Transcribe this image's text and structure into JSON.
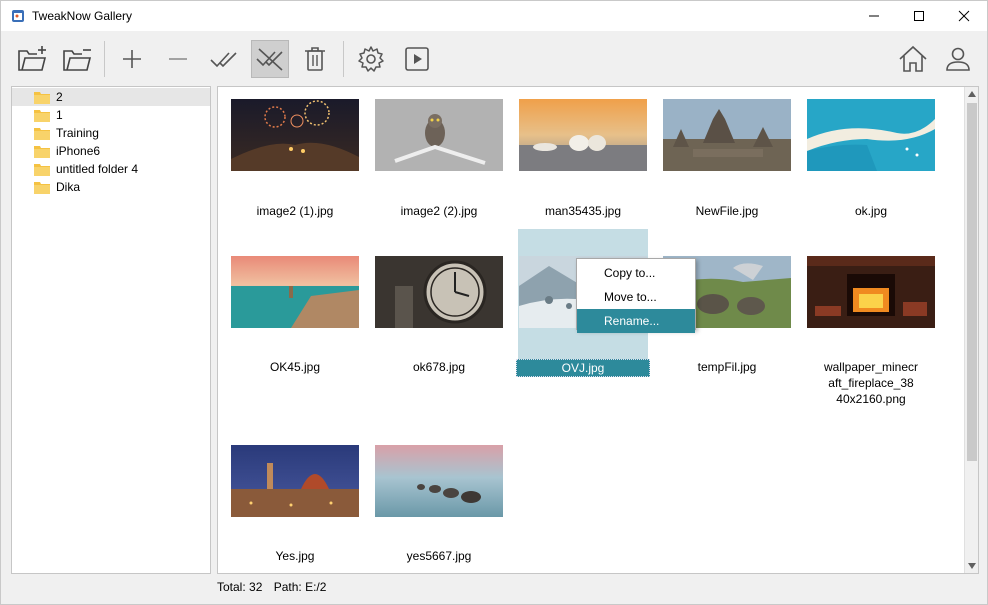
{
  "window": {
    "title": "TweakNow Gallery",
    "controls": [
      "minimize",
      "maximize",
      "close"
    ]
  },
  "toolbar": {
    "buttons": [
      {
        "name": "add-folder",
        "icon": "folder-plus-icon"
      },
      {
        "name": "remove-folder",
        "icon": "folder-minus-icon"
      },
      {
        "name": "add",
        "icon": "plus-icon"
      },
      {
        "name": "remove",
        "icon": "minus-icon"
      },
      {
        "name": "select-all",
        "icon": "double-check-icon"
      },
      {
        "name": "deselect-all",
        "icon": "double-check-off-icon",
        "active": true
      },
      {
        "name": "delete",
        "icon": "trash-icon"
      },
      {
        "name": "settings",
        "icon": "gear-icon"
      },
      {
        "name": "slideshow",
        "icon": "play-icon"
      },
      {
        "name": "home",
        "icon": "home-icon"
      },
      {
        "name": "account",
        "icon": "user-icon"
      }
    ]
  },
  "tree": {
    "items": [
      {
        "label": "2",
        "selected": true
      },
      {
        "label": "1"
      },
      {
        "label": "Training"
      },
      {
        "label": "iPhone6"
      },
      {
        "label": "untitled folder 4"
      },
      {
        "label": "Dika"
      }
    ]
  },
  "gallery": {
    "items": [
      {
        "filename": "image2 (1).jpg"
      },
      {
        "filename": "image2 (2).jpg"
      },
      {
        "filename": "man35435.jpg"
      },
      {
        "filename": "NewFile.jpg"
      },
      {
        "filename": "ok.jpg"
      },
      {
        "filename": "OK45.jpg"
      },
      {
        "filename": "ok678.jpg"
      },
      {
        "filename": "OVJ.jpg",
        "selected": true
      },
      {
        "filename": "tempFil.jpg"
      },
      {
        "filename_lines": [
          "wallpaper_minecr",
          "aft_fireplace_38",
          "40x2160.png"
        ]
      },
      {
        "filename": "Yes.jpg"
      },
      {
        "filename": "yes5667.jpg"
      }
    ]
  },
  "context_menu": {
    "items": [
      {
        "label": "Copy to..."
      },
      {
        "label": "Move to..."
      },
      {
        "label": "Rename...",
        "highlighted": true
      }
    ]
  },
  "status": {
    "total": "Total: 32",
    "path": "Path: E:/2"
  },
  "colors": {
    "accent": "#2d8a9b",
    "selection_bg": "#c5dde4",
    "folder": "#f5c242"
  }
}
